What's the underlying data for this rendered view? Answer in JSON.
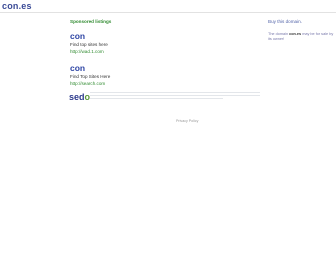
{
  "header": {
    "logo_text": "con.es"
  },
  "main": {
    "sponsored_label": "Sponsored listings",
    "listings": [
      {
        "title": "con",
        "description": "Find top sites here",
        "url": "http://wad.1.com"
      },
      {
        "title": "con",
        "description": "Find Top Sites Here",
        "url": "http://search.com"
      }
    ],
    "sedo_logo": {
      "prefix": "sed",
      "o": "o"
    },
    "privacy_link": "Privacy Policy"
  },
  "sidebar": {
    "buy_domain_label": "Buy this domain.",
    "owner_note_prefix": "The domain ",
    "owner_note_domain": "con.es",
    "owner_note_suffix": " may be for sale by its owner!"
  },
  "colors": {
    "brand_blue": "#2d44a4",
    "sponsored_green": "#2f8a2f"
  }
}
